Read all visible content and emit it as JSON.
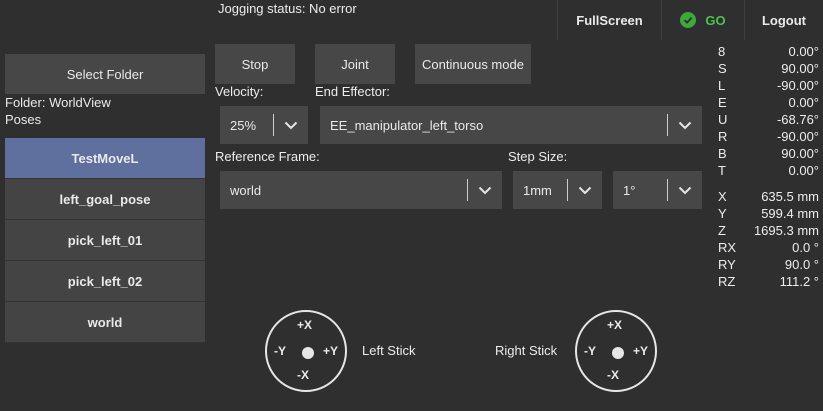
{
  "header": {
    "status": "Jogging status: No error",
    "fullscreen_label": "FullScreen",
    "go_label": "GO",
    "logout_label": "Logout"
  },
  "sidebar": {
    "select_folder_label": "Select Folder",
    "folder_text": "Folder: WorldView",
    "poses_text": "Poses",
    "poses": [
      "TestMoveL",
      "left_goal_pose",
      "pick_left_01",
      "pick_left_02",
      "world"
    ],
    "active_pose": "TestMoveL"
  },
  "controls": {
    "stop_label": "Stop",
    "joint_label": "Joint",
    "continuous_label": "Continuous mode",
    "velocity_label": "Velocity:",
    "velocity_value": "25%",
    "end_effector_label": "End Effector:",
    "end_effector_value": "EE_manipulator_left_torso",
    "reference_frame_label": "Reference Frame:",
    "reference_frame_value": "world",
    "step_size_label": "Step Size:",
    "step_size_value": "1mm",
    "angle_step_value": "1°"
  },
  "joints": [
    {
      "name": "8",
      "value": "0.00°"
    },
    {
      "name": "S",
      "value": "90.00°"
    },
    {
      "name": "L",
      "value": "-90.00°"
    },
    {
      "name": "E",
      "value": "0.00°"
    },
    {
      "name": "U",
      "value": "-68.76°"
    },
    {
      "name": "R",
      "value": "-90.00°"
    },
    {
      "name": "B",
      "value": "90.00°"
    },
    {
      "name": "T",
      "value": "0.00°"
    }
  ],
  "pose": [
    {
      "name": "X",
      "value": "635.5 mm"
    },
    {
      "name": "Y",
      "value": "599.4 mm"
    },
    {
      "name": "Z",
      "value": "1695.3 mm"
    },
    {
      "name": "RX",
      "value": "0.0 °"
    },
    {
      "name": "RY",
      "value": "90.0 °"
    },
    {
      "name": "RZ",
      "value": "111.2 °"
    }
  ],
  "sticks": {
    "left_label": "Left Stick",
    "right_label": "Right Stick",
    "up": "+X",
    "down": "-X",
    "left": "-Y",
    "right": "+Y"
  },
  "colors": {
    "background": "#2f2f2f",
    "button": "#474747",
    "active_pose": "#5f6f9e",
    "go": "#4cc24c"
  }
}
